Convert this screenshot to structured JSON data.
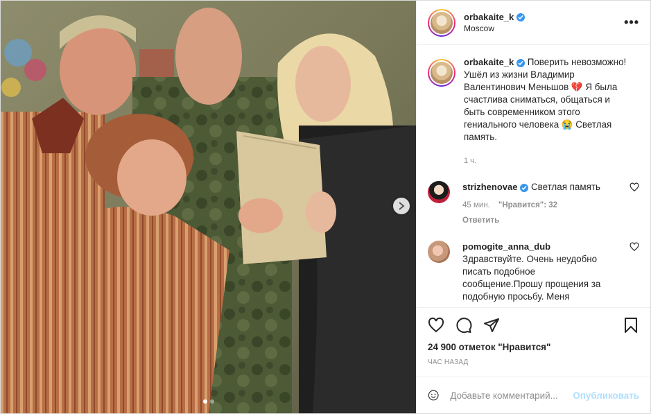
{
  "post": {
    "username": "orbakaite_k",
    "location": "Moscow",
    "more_icon": "more-horizontal-icon"
  },
  "caption": {
    "username": "orbakaite_k",
    "text": "Поверить невозможно! Ушёл из жизни Владимир Валентинович Меньшов 💔 Я была счастлива сниматься, общаться и быть современником этого гениального человека 😭 Светлая память.",
    "time": "1 ч."
  },
  "comments": [
    {
      "username": "strizhenovae",
      "verified": true,
      "text": "Светлая память",
      "time": "45 мин.",
      "likes": "\"Нравится\": 32",
      "reply": "Ответить"
    },
    {
      "username": "pomogite_anna_dub",
      "verified": false,
      "text": "Здравствуйте. Очень неудобно писать подобное сообщение.Прошу прощения за подобную просьбу. Меня"
    }
  ],
  "stats": {
    "likes": "24 900 отметок \"Нравится\"",
    "posted": "ЧАС НАЗАД"
  },
  "composer": {
    "placeholder": "Добавьте комментарий...",
    "publish": "Опубликовать"
  },
  "carousel": {
    "slides": 2,
    "current": 1
  },
  "colors": {
    "verified": "#3897f0",
    "publish_disabled": "#b2dffc",
    "meta": "#8e8e8e"
  }
}
